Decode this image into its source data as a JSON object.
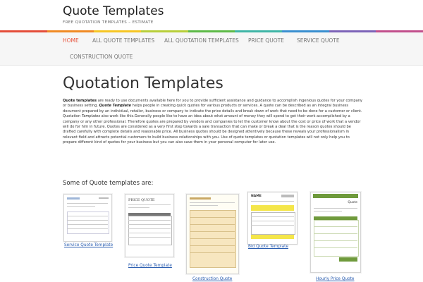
{
  "header": {
    "site_title": "Quote Templates",
    "tagline": "FREE QUOTATION TEMPLATES – ESTIMATE"
  },
  "colors": {
    "accent": "#e8553f",
    "link": "#2a5db0",
    "rainbow": [
      "#e44d3a",
      "#f08a24",
      "#f6c624",
      "#b8cf3a",
      "#5dba47",
      "#3fb5a6",
      "#3a8fd0",
      "#7d63b8",
      "#c24f8c"
    ]
  },
  "nav": {
    "items": [
      {
        "label": "HOME"
      },
      {
        "label": "ALL QUOTE TEMPLATES"
      },
      {
        "label": "ALL QUOTATION TEMPLATES"
      },
      {
        "label": "PRICE QUOTE"
      },
      {
        "label": "SERVICE QUOTE"
      },
      {
        "label": "CONSTRUCTION QUOTE"
      }
    ]
  },
  "main": {
    "title": "Quotation Templates",
    "intro_bold": "Quote templates",
    "intro_1": " are ready to use documents available here for you to provide sufficient assistance and guidance to accomplish ingenious quotes for your company or business setting. ",
    "intro_italic": "Quote Template",
    "intro_2": " helps people in creating quick quotes for various products or services. A quote can be described as an integral business document prepared by an individual, retailer, business or company to indicate the price details and break down of work that need to be done for a customer or client. Quotation ",
    "intro_italic2": "Templates",
    "intro_3": " also work like this.Generally people like to have an idea about what amount of money they will spend to get their work accomplished by a company or any other professional. Therefore quotes are prepared by vendors and companies to let the customer know about the cost or price of work that a vendor will do for him in future. Quotes are considered as a very first step towards a sale transaction that can make or break a deal that is the reason quotes should be drafted carefully with complete details and reasonable price. All business quotes should be designed attentively because these reveals your professionalism in relevant field and attracts potential customers to build business relationships with you. Use of quote templates or quotation templates will not only help you to prepare different kind of quotes for your business but you can also save them in your personal computer for later use.",
    "sub_heading": "Some of Quote templates are:",
    "thumbnails": [
      {
        "caption": "Service Quote Template",
        "icon": "document-thumbnail-service"
      },
      {
        "caption": "Price Quote Template",
        "icon": "document-thumbnail-price",
        "label": "PRICE QUOTE"
      },
      {
        "caption": "Construction Quote",
        "icon": "document-thumbnail-construction"
      },
      {
        "caption": "Bid Quote Template",
        "icon": "document-thumbnail-bid",
        "label": "NAME"
      },
      {
        "caption": "Hourly Price Quote",
        "icon": "document-thumbnail-hourly",
        "label": "Quote"
      }
    ]
  }
}
